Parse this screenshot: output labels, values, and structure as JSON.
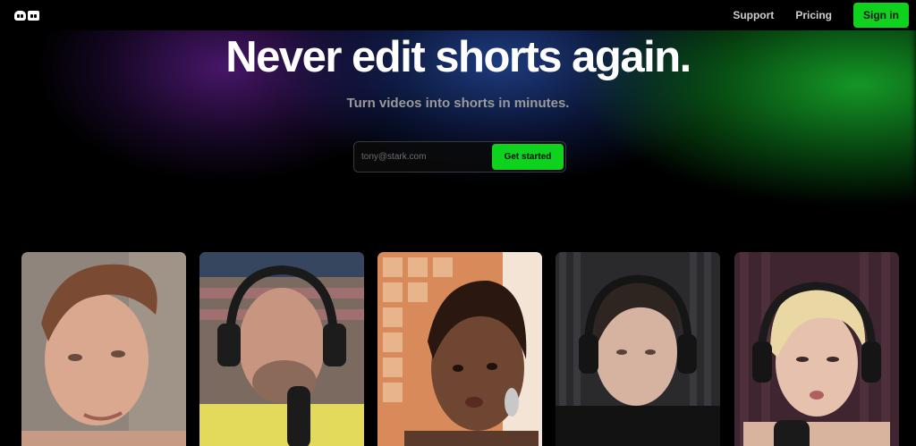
{
  "nav": {
    "support_label": "Support",
    "pricing_label": "Pricing",
    "signin_label": "Sign in"
  },
  "hero": {
    "title": "Never edit shorts again.",
    "subtitle": "Turn videos into shorts in minutes."
  },
  "signup": {
    "email_placeholder": "tony@stark.com",
    "button_label": "Get started"
  },
  "icons": {
    "logo": "logo-eyes-icon"
  },
  "colors": {
    "accent": "#0fd21f",
    "background": "#000000"
  }
}
